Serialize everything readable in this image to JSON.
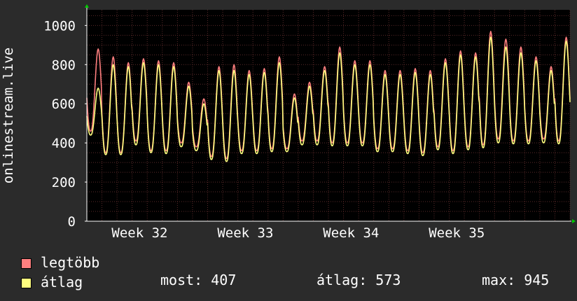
{
  "chart_data": {
    "type": "line",
    "ylabel": "onlinestream.live",
    "ylim": [
      0,
      1080
    ],
    "yticks": [
      0,
      200,
      400,
      600,
      800,
      1000
    ],
    "xticks": [
      "Week 32",
      "Week 33",
      "Week 34",
      "Week 35"
    ],
    "grid": true,
    "legend_position": "bottom-left",
    "series": [
      {
        "name": "legtöbb",
        "color": "#ff7f7f",
        "daily_peaks": [
          880,
          840,
          810,
          830,
          820,
          810,
          710,
          625,
          790,
          800,
          770,
          780,
          840,
          650,
          710,
          790,
          890,
          820,
          820,
          770,
          770,
          780,
          770,
          830,
          870,
          860,
          970,
          930,
          890,
          840,
          790,
          940
        ],
        "daily_troughs": [
          460,
          350,
          350,
          410,
          360,
          360,
          400,
          380,
          330,
          320,
          360,
          360,
          370,
          370,
          410,
          410,
          400,
          400,
          400,
          370,
          370,
          360,
          350,
          380,
          360,
          380,
          390,
          420,
          410,
          410,
          420,
          410
        ],
        "last": 410
      },
      {
        "name": "átlag",
        "color": "#ffff7f",
        "daily_peaks": [
          680,
          800,
          790,
          810,
          800,
          790,
          690,
          600,
          770,
          770,
          750,
          760,
          810,
          630,
          690,
          770,
          860,
          800,
          800,
          750,
          750,
          760,
          750,
          810,
          850,
          840,
          940,
          890,
          860,
          820,
          770,
          920
        ],
        "daily_troughs": [
          440,
          340,
          340,
          390,
          350,
          345,
          380,
          360,
          315,
          305,
          345,
          345,
          355,
          355,
          390,
          390,
          385,
          385,
          385,
          355,
          355,
          345,
          335,
          365,
          345,
          365,
          375,
          400,
          395,
          395,
          400,
          395
        ],
        "last": 407
      }
    ],
    "stats": {
      "most_label": "most:",
      "most": 407,
      "atlag_label": "átlag:",
      "atlag": 573,
      "max_label": "max:",
      "max": 945
    }
  },
  "colors": {
    "background": "#2b2b2b",
    "plot": "#000000",
    "grid": "#5a2a2a",
    "axis": "#ffffff",
    "arrow": "#00cc00"
  }
}
